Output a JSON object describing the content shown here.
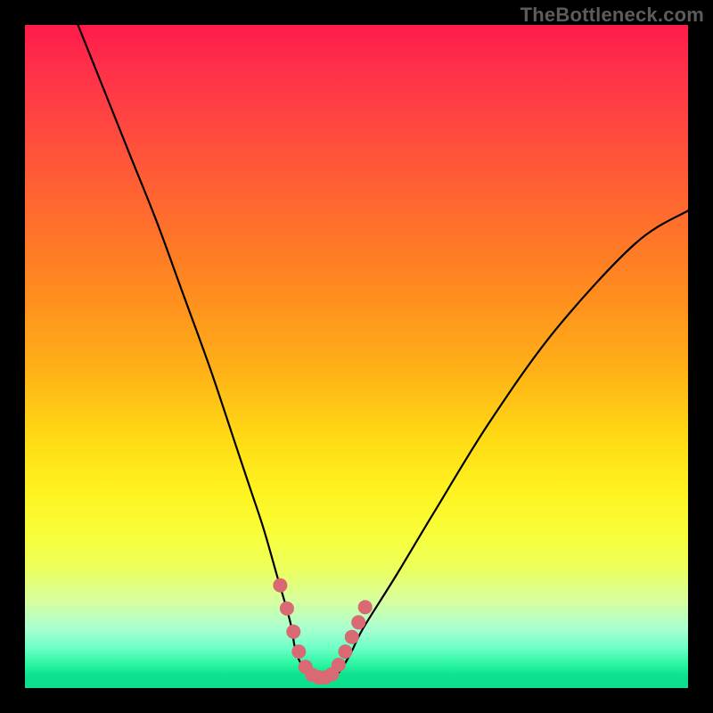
{
  "watermark": {
    "text": "TheBottleneck.com"
  },
  "chart_data": {
    "type": "line",
    "title": "",
    "xlabel": "",
    "ylabel": "",
    "xlim": [
      0,
      100
    ],
    "ylim": [
      0,
      100
    ],
    "grid": false,
    "series": [
      {
        "name": "bottleneck-curve",
        "x": [
          8,
          12,
          16,
          20,
          24,
          28,
          32,
          34,
          36,
          38,
          40,
          41,
          43,
          45,
          47,
          49,
          51,
          56,
          62,
          70,
          80,
          92,
          100
        ],
        "values": [
          100,
          90,
          80,
          70,
          59,
          48,
          36,
          30,
          24,
          17,
          10,
          5,
          2,
          1.5,
          2,
          5,
          9,
          17,
          27,
          40,
          54,
          67,
          72
        ]
      },
      {
        "name": "optimal-region-marker",
        "x": [
          38.5,
          39.5,
          40.5,
          41.3,
          42.3,
          43.3,
          44.3,
          45.3,
          46.3,
          47.3,
          48.3,
          49.3,
          50.3,
          51.3
        ],
        "values": [
          15.5,
          12.0,
          8.5,
          5.5,
          3.2,
          2.0,
          1.6,
          1.6,
          2.1,
          3.5,
          5.5,
          7.7,
          9.9,
          12.2
        ]
      }
    ],
    "gradient_stops": [
      {
        "pos": 0.0,
        "color": "#ff1b4a"
      },
      {
        "pos": 0.4,
        "color": "#ff8b1f"
      },
      {
        "pos": 0.7,
        "color": "#fff21f"
      },
      {
        "pos": 0.92,
        "color": "#6cffc6"
      },
      {
        "pos": 1.0,
        "color": "#0adf8b"
      }
    ],
    "marker_color": "#d96a74"
  }
}
